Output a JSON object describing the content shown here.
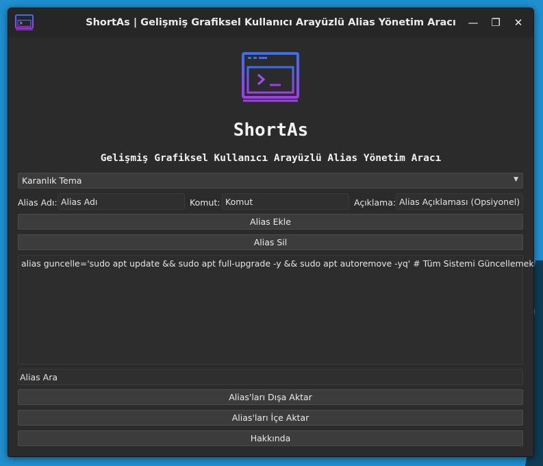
{
  "window": {
    "title": "ShortAs | Gelişmiş Grafiksel Kullanıcı Arayüzlü Alias Yönetim Aracı",
    "controls": {
      "minimize": "—",
      "maximize": "❐",
      "close": "✕"
    }
  },
  "header": {
    "app_name": "ShortAs",
    "subtitle": "Gelişmiş Grafiksel Kullanıcı Arayüzlü Alias Yönetim Aracı"
  },
  "theme_select": {
    "selected": "Karanlık Tema",
    "arrow": "▼"
  },
  "form": {
    "alias_name_label": "Alias Adı:",
    "alias_name_placeholder": "Alias Adı",
    "command_label": "Komut:",
    "command_placeholder": "Komut",
    "description_label": "Açıklama:",
    "description_placeholder": "Alias Açıklaması (Opsiyonel)"
  },
  "buttons": {
    "add": "Alias Ekle",
    "delete": "Alias Sil",
    "export": "Alias'ları Dışa Aktar",
    "import": "Alias'ları İçe Aktar",
    "about": "Hakkında"
  },
  "alias_list": [
    "alias guncelle='sudo apt update && sudo apt full-upgrade -y && sudo apt autoremove -yq'  # Tüm Sistemi Güncellemek İçin"
  ],
  "search": {
    "placeholder": "Alias Ara"
  },
  "colors": {
    "window_bg": "#2b2b2b",
    "logo_gradient_top": "#3b6ff0",
    "logo_gradient_bottom": "#a23cf0"
  },
  "icons": {
    "app_icon": "terminal-window-icon"
  }
}
